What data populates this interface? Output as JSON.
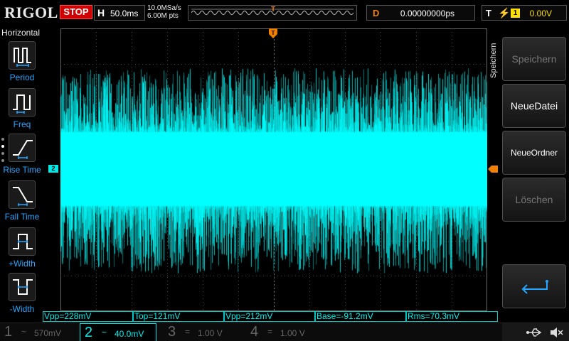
{
  "topbar": {
    "logo": "RIGOL",
    "run_state": "STOP",
    "horizontal_label": "H",
    "timebase": "50.0ms",
    "sample_rate": "10.0MSa/s",
    "memory_depth": "6.00M pts",
    "trigger_pos_marker": "T",
    "delay_label": "D",
    "delay_value": "0.00000000ps",
    "trigger_label": "T",
    "trigger_edge_icon": "rising-edge-icon",
    "trigger_source": "1",
    "trigger_level": "0.00V"
  },
  "left_menu": {
    "title": "Horizontal",
    "items": [
      {
        "label": "Period",
        "icon": "period-icon"
      },
      {
        "label": "Freq",
        "icon": "frequency-icon"
      },
      {
        "label": "Rise Time",
        "icon": "rise-time-icon"
      },
      {
        "label": "Fall Time",
        "icon": "fall-time-icon"
      },
      {
        "label": "+Width",
        "icon": "positive-width-icon"
      },
      {
        "label": "-Width",
        "icon": "negative-width-icon"
      }
    ]
  },
  "right_menu": {
    "title": "Speichern",
    "softkeys": [
      {
        "label": "Speichern",
        "enabled": false
      },
      {
        "label": "NeueDatei",
        "enabled": true
      },
      {
        "label": "NeueOrdner",
        "enabled": true
      },
      {
        "label": "Löschen",
        "enabled": false
      }
    ],
    "return_icon": "return-arrow-icon"
  },
  "screen": {
    "channel_marker": "2",
    "trace_color": "#00ffff"
  },
  "measurements": [
    {
      "text": "Vpp=228mV"
    },
    {
      "text": "Top=121mV"
    },
    {
      "text": "Vpp=212mV"
    },
    {
      "text": "Base=-91.2mV"
    },
    {
      "text": "Rms=70.3mV"
    }
  ],
  "channels": [
    {
      "number": "1",
      "coupling": "~",
      "scale": "570mV",
      "state": "off"
    },
    {
      "number": "2",
      "coupling": "~",
      "scale": "40.0mV",
      "state": "active"
    },
    {
      "number": "3",
      "coupling": "=",
      "scale": "1.00 V",
      "state": "off"
    },
    {
      "number": "4",
      "coupling": "=",
      "scale": "1.00 V",
      "state": "off"
    }
  ],
  "status": {
    "usb_icon": "usb-icon",
    "sound_icon": "speaker-muted-icon"
  },
  "colors": {
    "ch2": "#00e8e8",
    "trigger": "#f08000",
    "ch1": "#ffe000",
    "accent_blue": "#27a6ff",
    "stop_red": "#d10000"
  }
}
